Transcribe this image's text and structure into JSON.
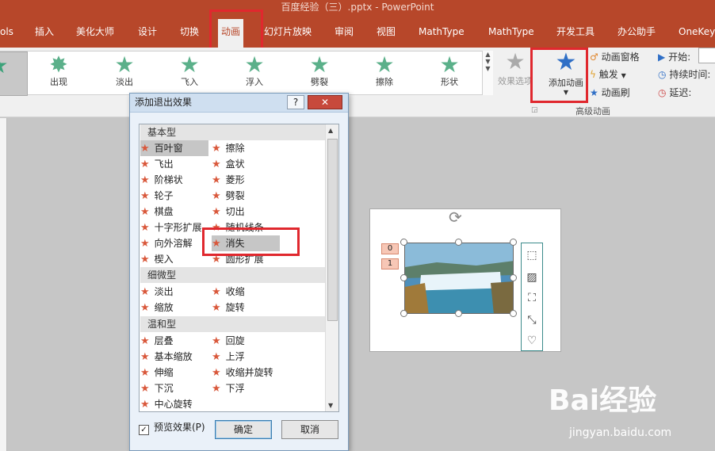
{
  "window": {
    "title": "百度经验（三）.pptx - PowerPoint"
  },
  "tabs": [
    "ols",
    "插入",
    "美化大师",
    "设计",
    "切换",
    "动画",
    "幻灯片放映",
    "审阅",
    "视图",
    "MathType",
    "MathType",
    "开发工具",
    "办公助手",
    "OneKey"
  ],
  "gallery": [
    {
      "label": "出现"
    },
    {
      "label": "淡出"
    },
    {
      "label": "飞入"
    },
    {
      "label": "浮入"
    },
    {
      "label": "劈裂"
    },
    {
      "label": "擦除"
    },
    {
      "label": "形状"
    }
  ],
  "ribbon": {
    "effect_options": "效果选项",
    "add_animation": "添加动画",
    "animation_pane": "动画窗格",
    "trigger": "触发",
    "animation_painter": "动画刷",
    "advanced_group": "高级动画",
    "start": "开始:",
    "duration": "持续时间:",
    "delay": "延迟:"
  },
  "dialog": {
    "title": "添加退出效果",
    "help": "?",
    "close": "✕",
    "categories": [
      "基本型",
      "细微型",
      "温和型"
    ],
    "basic": [
      "百叶窗",
      "擦除",
      "飞出",
      "盒状",
      "阶梯状",
      "菱形",
      "轮子",
      "劈裂",
      "棋盘",
      "切出",
      "十字形扩展",
      "随机线条",
      "向外溶解",
      "消失",
      "楔入",
      "圆形扩展"
    ],
    "subtle": [
      "淡出",
      "收缩",
      "缩放",
      "旋转"
    ],
    "moderate": [
      "层叠",
      "回旋",
      "基本缩放",
      "上浮",
      "伸缩",
      "收缩并旋转",
      "下沉",
      "下浮",
      "中心旋转"
    ],
    "preview_label": "预览效果(P)",
    "ok": "确定",
    "cancel": "取消"
  },
  "slide": {
    "tags": [
      "0",
      "1"
    ]
  },
  "watermark": {
    "brand": "Bai经验",
    "url": "jingyan.baidu.com"
  }
}
